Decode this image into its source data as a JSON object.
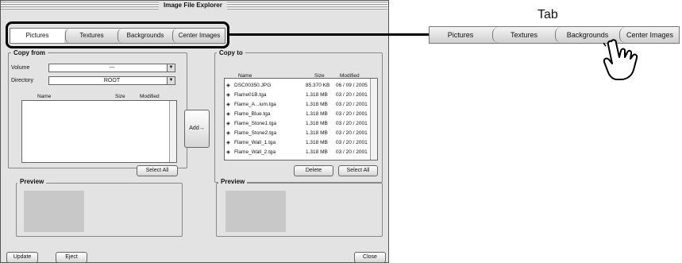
{
  "window": {
    "title": "Image File Explorer"
  },
  "tabs": [
    {
      "label": "Pictures"
    },
    {
      "label": "Textures"
    },
    {
      "label": "Backgrounds"
    },
    {
      "label": "Center Images"
    }
  ],
  "callout": {
    "label": "Tab"
  },
  "copy_from": {
    "title": "Copy from",
    "volume_label": "Volume",
    "volume_value": "---",
    "directory_label": "Directory",
    "directory_value": "ROOT",
    "columns": [
      "Name",
      "Size",
      "Modified"
    ],
    "select_all": "Select All",
    "preview": "Preview"
  },
  "add_button": "Add→",
  "copy_to": {
    "title": "Copy to",
    "columns": [
      "Name",
      "Size",
      "Modified"
    ],
    "files": [
      {
        "name": "DSC00350.JPG",
        "size": "85.370 KB",
        "modified": "06 / 09 / 2005"
      },
      {
        "name": "Flame01B.tga",
        "size": "1.318 MB",
        "modified": "03 / 20 / 2001"
      },
      {
        "name": "Flame_A...ium.tga",
        "size": "1.318 MB",
        "modified": "03 / 20 / 2001"
      },
      {
        "name": "Flame_Blue.tga",
        "size": "1.318 MB",
        "modified": "03 / 20 / 2001"
      },
      {
        "name": "Flame_Stone1.tga",
        "size": "1.318 MB",
        "modified": "03 / 20 / 2001"
      },
      {
        "name": "Flame_Stone2.tga",
        "size": "1.318 MB",
        "modified": "03 / 20 / 2001"
      },
      {
        "name": "Flame_Wall_1.tga",
        "size": "1.318 MB",
        "modified": "03 / 20 / 2001"
      },
      {
        "name": "Flame_Wall_2.tga",
        "size": "1.318 MB",
        "modified": "03 / 20 / 2001"
      }
    ],
    "delete": "Delete",
    "select_all": "Select All",
    "preview": "Preview"
  },
  "bottom": {
    "update": "Update",
    "eject": "Eject",
    "close": "Close"
  },
  "icons": {
    "file": "file-diamond-icon",
    "hand": "pointing-hand-icon"
  }
}
